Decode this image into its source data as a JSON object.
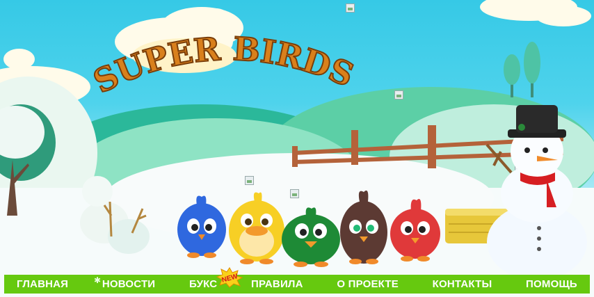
{
  "logo": {
    "text": "SUPER BIRDS"
  },
  "nav": {
    "items": [
      {
        "label": "ГЛАВНАЯ"
      },
      {
        "label": "НОВОСТИ"
      },
      {
        "label": "БУКС"
      },
      {
        "label": "ПРАВИЛА"
      },
      {
        "label": "О ПРОЕКТЕ"
      },
      {
        "label": "КОНТАКТЫ"
      },
      {
        "label": "ПОМОЩЬ"
      }
    ],
    "new_badge": "NEW"
  },
  "colors": {
    "nav_bg": "#66c90f",
    "logo_orange": "#d9801c",
    "sky": "#36c9e6"
  },
  "birds": [
    "blue",
    "yellow",
    "green",
    "brown",
    "red"
  ]
}
